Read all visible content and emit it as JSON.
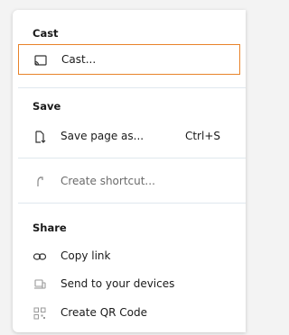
{
  "menu": {
    "cast_section": {
      "title": "Cast",
      "cast_label": "Cast..."
    },
    "save_section": {
      "title": "Save",
      "save_page_label": "Save page as...",
      "save_page_shortcut": "Ctrl+S",
      "create_shortcut_label": "Create shortcut..."
    },
    "share_section": {
      "title": "Share",
      "copy_link_label": "Copy link",
      "send_devices_label": "Send to your devices",
      "qr_code_label": "Create QR Code"
    }
  },
  "icons": {
    "cast": "cast-icon",
    "save_page": "save-page-icon",
    "create_shortcut": "shortcut-icon",
    "copy_link": "link-icon",
    "send_devices": "devices-icon",
    "qr_code": "qr-code-icon"
  },
  "colors": {
    "focus_outline": "#e8832a",
    "divider": "#dfe8ee",
    "disabled_text": "#6b6b6b"
  }
}
